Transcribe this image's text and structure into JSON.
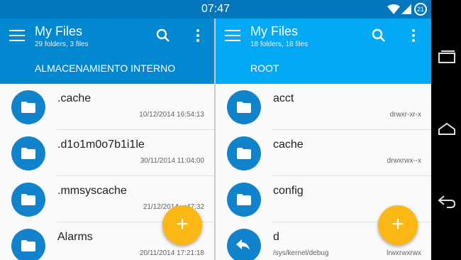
{
  "status_bar": {
    "time": "07:47",
    "battery_level": "21"
  },
  "left_pane": {
    "title": "My Files",
    "subtitle": "29 folders, 3 files",
    "path": "ALMACENAMIENTO INTERNO",
    "items": [
      {
        "name": ".cache",
        "meta": "10/12/2014 16:54:13"
      },
      {
        "name": ".d1o1m0o7b1i1le",
        "meta": "30/11/2014 11:04:00"
      },
      {
        "name": ".mmsyscache",
        "meta": "21/12/2014 ..:47:32"
      },
      {
        "name": "Alarms",
        "meta": "20/11/2014 17:21:18"
      }
    ],
    "fab_label": "+"
  },
  "right_pane": {
    "title": "My Files",
    "subtitle": "18 folders, 18 files",
    "path": "ROOT",
    "items": [
      {
        "name": "acct",
        "meta": "drwxr-xr-x",
        "link": ""
      },
      {
        "name": "cache",
        "meta": "drwxrwx--x",
        "link": ""
      },
      {
        "name": "config",
        "meta": "",
        "link": ""
      },
      {
        "name": "d",
        "meta": "lrwxrwxrwx",
        "link": "/sys/kernel/debug"
      }
    ],
    "fab_label": "+"
  },
  "colors": {
    "left_appbar": "#0288d1",
    "right_appbar": "#03a9f4",
    "folder_circle": "#1183cc",
    "fab": "#fbb714"
  },
  "icons": [
    "menu-icon",
    "search-icon",
    "more-vert-icon",
    "folder-icon",
    "symlink-icon",
    "add-icon",
    "wifi-icon",
    "signal-icon",
    "battery-icon",
    "recents-icon",
    "home-icon",
    "back-icon"
  ]
}
